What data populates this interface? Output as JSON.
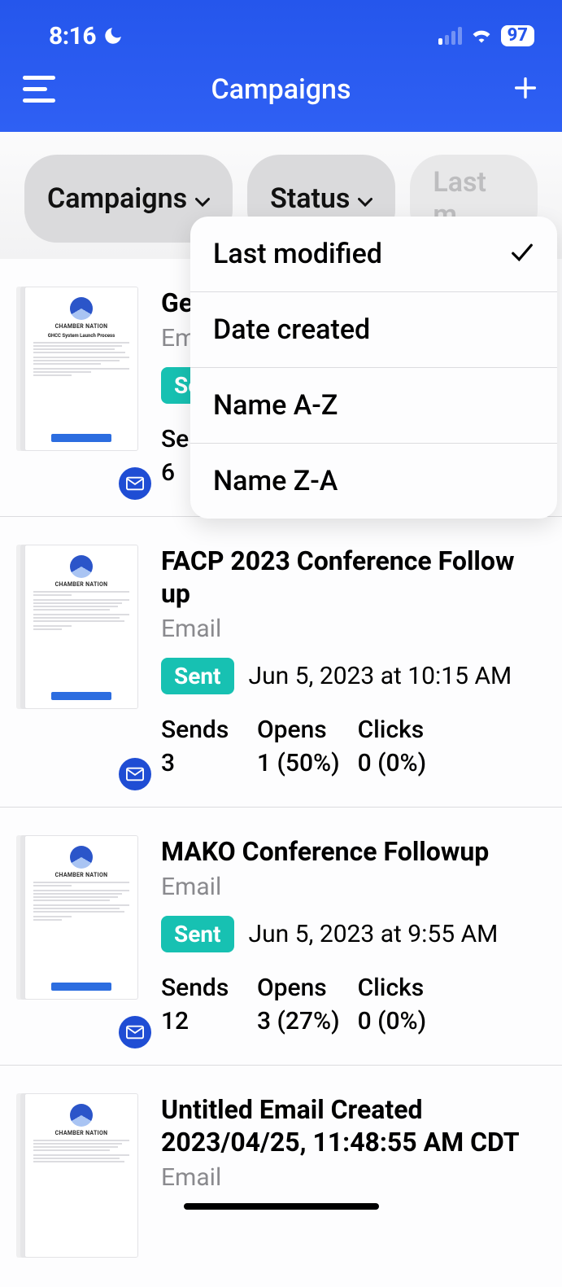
{
  "status_bar": {
    "time": "8:16",
    "battery": "97"
  },
  "header": {
    "title": "Campaigns"
  },
  "filters": {
    "campaigns": "Campaigns",
    "status": "Status",
    "sort_pill": "Last m"
  },
  "sort_menu": {
    "last_modified": "Last modified",
    "date_created": "Date created",
    "name_az": "Name A-Z",
    "name_za": "Name Z-A",
    "selected": "last_modified"
  },
  "thumb_common": {
    "brand": "CHAMBER NATION",
    "subject": "GHCC System Launch Process"
  },
  "metrics_labels": {
    "sends": "Sends",
    "opens": "Opens",
    "clicks": "Clicks"
  },
  "campaigns": [
    {
      "title": "Ge… Co…",
      "type": "Em…",
      "status": "Se…",
      "timestamp": "",
      "sends": "6",
      "opens": "",
      "clicks": ""
    },
    {
      "title": "FACP 2023 Conference Follow up",
      "type": "Email",
      "status": "Sent",
      "timestamp": "Jun 5, 2023 at 10:15 AM",
      "sends": "3",
      "opens": "1 (50%)",
      "clicks": "0 (0%)"
    },
    {
      "title": "MAKO Conference Followup",
      "type": "Email",
      "status": "Sent",
      "timestamp": "Jun 5, 2023 at 9:55 AM",
      "sends": "12",
      "opens": "3 (27%)",
      "clicks": "0 (0%)"
    },
    {
      "title": "Untitled Email Created 2023/04/25, 11:48:55 AM CDT",
      "type": "Email",
      "status": "",
      "timestamp": "",
      "sends": "",
      "opens": "",
      "clicks": ""
    }
  ]
}
